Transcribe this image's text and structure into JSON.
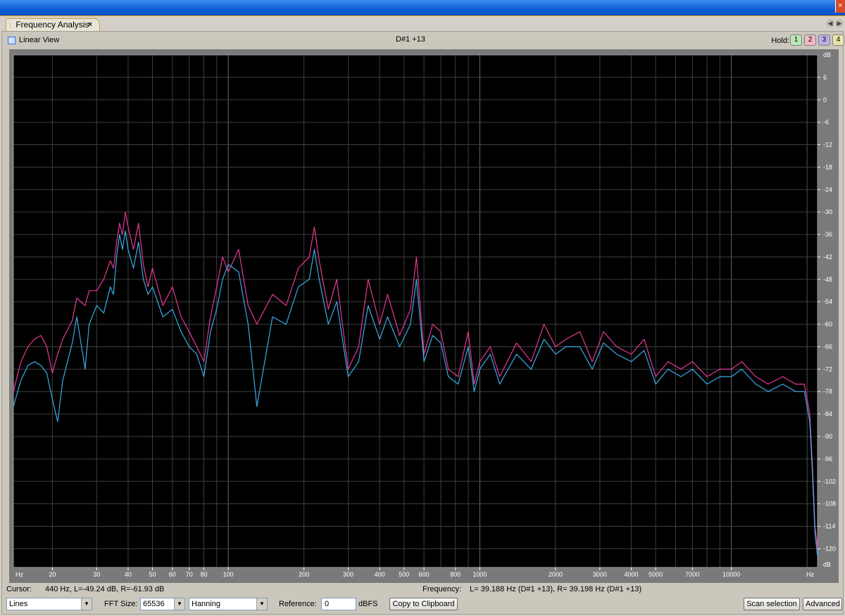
{
  "window": {
    "close_glyph": "×"
  },
  "tab": {
    "label": "Frequency Analysis",
    "close_glyph": "×",
    "grip_glyph": "⁝"
  },
  "tab_scroll": {
    "left_glyph": "◀",
    "right_glyph": "▶"
  },
  "toolbar": {
    "linear_view_label": "Linear View",
    "linear_view_checked": false,
    "pitch_readout": "D#1 +13",
    "hold_label": "Hold:",
    "hold_buttons": [
      "1",
      "2",
      "3",
      "4"
    ]
  },
  "status": {
    "cursor_label": "Cursor:",
    "cursor_value": "440 Hz, L=-49.24 dB, R=-61.93 dB",
    "frequency_label": "Frequency:",
    "frequency_value": "L= 39.188 Hz (D#1 +13), R= 39.198 Hz (D#1 +13)"
  },
  "controls": {
    "plot_style": "Lines",
    "fft_size_label": "FFT Size:",
    "fft_size": "65536",
    "window_function": "Hanning",
    "reference_label": "Reference:",
    "reference_value": "0",
    "reference_unit": "dBFS",
    "copy_button": "Copy to Clipboard",
    "scan_button": "Scan selection",
    "advanced_button": "Advanced"
  },
  "chart_data": {
    "type": "line",
    "x_scale": "log",
    "xlim": [
      14,
      22000
    ],
    "ylim": [
      -125,
      12
    ],
    "grid": true,
    "background": "#000000",
    "x_unit_left": "Hz",
    "x_unit_right": "Hz",
    "y_unit_top": "dB",
    "y_unit_bottom": "dB",
    "x_tick_labels": [
      {
        "v": 20,
        "t": "20"
      },
      {
        "v": 30,
        "t": "30"
      },
      {
        "v": 40,
        "t": "40"
      },
      {
        "v": 50,
        "t": "50"
      },
      {
        "v": 60,
        "t": "60"
      },
      {
        "v": 70,
        "t": "70"
      },
      {
        "v": 80,
        "t": "80"
      },
      {
        "v": 100,
        "t": "100"
      },
      {
        "v": 200,
        "t": "200"
      },
      {
        "v": 300,
        "t": "300"
      },
      {
        "v": 400,
        "t": "400"
      },
      {
        "v": 500,
        "t": "500"
      },
      {
        "v": 600,
        "t": "600"
      },
      {
        "v": 800,
        "t": "800"
      },
      {
        "v": 1000,
        "t": "1000"
      },
      {
        "v": 2000,
        "t": "2000"
      },
      {
        "v": 3000,
        "t": "3000"
      },
      {
        "v": 4000,
        "t": "4000"
      },
      {
        "v": 5000,
        "t": "5000"
      },
      {
        "v": 7000,
        "t": "7000"
      },
      {
        "v": 10000,
        "t": "10000"
      }
    ],
    "y_ticks": [
      6,
      0,
      -6,
      -12,
      -18,
      -24,
      -30,
      -36,
      -42,
      -48,
      -54,
      -60,
      -66,
      -72,
      -78,
      -84,
      -90,
      -96,
      -102,
      -108,
      -114,
      -120
    ],
    "series": [
      {
        "color": "#ff3ea5",
        "points": [
          [
            14,
            -78
          ],
          [
            15,
            -70
          ],
          [
            16,
            -66
          ],
          [
            17,
            -64
          ],
          [
            18,
            -63
          ],
          [
            19,
            -66
          ],
          [
            20,
            -73
          ],
          [
            21,
            -68
          ],
          [
            22,
            -64
          ],
          [
            24,
            -59
          ],
          [
            25,
            -53
          ],
          [
            27,
            -55
          ],
          [
            28,
            -51
          ],
          [
            30,
            -51
          ],
          [
            32,
            -48
          ],
          [
            34,
            -43
          ],
          [
            35,
            -45
          ],
          [
            36,
            -38
          ],
          [
            37,
            -33
          ],
          [
            38,
            -36
          ],
          [
            39,
            -30
          ],
          [
            40,
            -34
          ],
          [
            42,
            -40
          ],
          [
            44,
            -33
          ],
          [
            46,
            -44
          ],
          [
            48,
            -50
          ],
          [
            50,
            -45
          ],
          [
            55,
            -55
          ],
          [
            60,
            -50
          ],
          [
            65,
            -58
          ],
          [
            70,
            -62
          ],
          [
            75,
            -66
          ],
          [
            80,
            -70
          ],
          [
            85,
            -58
          ],
          [
            90,
            -50
          ],
          [
            95,
            -42
          ],
          [
            100,
            -46
          ],
          [
            110,
            -40
          ],
          [
            120,
            -55
          ],
          [
            130,
            -60
          ],
          [
            150,
            -52
          ],
          [
            170,
            -55
          ],
          [
            190,
            -45
          ],
          [
            210,
            -42
          ],
          [
            220,
            -34
          ],
          [
            230,
            -43
          ],
          [
            250,
            -56
          ],
          [
            270,
            -48
          ],
          [
            300,
            -72
          ],
          [
            330,
            -66
          ],
          [
            360,
            -48
          ],
          [
            400,
            -60
          ],
          [
            430,
            -52
          ],
          [
            480,
            -63
          ],
          [
            530,
            -56
          ],
          [
            560,
            -42
          ],
          [
            600,
            -68
          ],
          [
            650,
            -60
          ],
          [
            700,
            -62
          ],
          [
            750,
            -72
          ],
          [
            820,
            -74
          ],
          [
            900,
            -62
          ],
          [
            950,
            -76
          ],
          [
            1000,
            -70
          ],
          [
            1100,
            -66
          ],
          [
            1200,
            -74
          ],
          [
            1400,
            -65
          ],
          [
            1600,
            -70
          ],
          [
            1800,
            -60
          ],
          [
            2000,
            -66
          ],
          [
            2200,
            -64
          ],
          [
            2500,
            -62
          ],
          [
            2800,
            -70
          ],
          [
            3100,
            -62
          ],
          [
            3500,
            -66
          ],
          [
            4000,
            -68
          ],
          [
            4500,
            -64
          ],
          [
            5000,
            -74
          ],
          [
            5600,
            -70
          ],
          [
            6300,
            -72
          ],
          [
            7000,
            -70
          ],
          [
            8000,
            -74
          ],
          [
            9000,
            -72
          ],
          [
            10000,
            -72
          ],
          [
            11000,
            -70
          ],
          [
            12500,
            -74
          ],
          [
            14000,
            -76
          ],
          [
            16000,
            -74
          ],
          [
            18000,
            -76
          ],
          [
            19500,
            -76
          ],
          [
            20500,
            -84
          ],
          [
            21000,
            -98
          ],
          [
            21500,
            -114
          ],
          [
            22000,
            -120
          ]
        ]
      },
      {
        "color": "#3ec0ff",
        "points": [
          [
            14,
            -82
          ],
          [
            15,
            -75
          ],
          [
            16,
            -71
          ],
          [
            17,
            -70
          ],
          [
            18,
            -71
          ],
          [
            19,
            -73
          ],
          [
            20,
            -80
          ],
          [
            21,
            -86
          ],
          [
            22,
            -75
          ],
          [
            24,
            -65
          ],
          [
            25,
            -58
          ],
          [
            27,
            -72
          ],
          [
            28,
            -60
          ],
          [
            30,
            -55
          ],
          [
            32,
            -57
          ],
          [
            34,
            -50
          ],
          [
            35,
            -52
          ],
          [
            36,
            -42
          ],
          [
            37,
            -36
          ],
          [
            38,
            -40
          ],
          [
            39,
            -35
          ],
          [
            40,
            -40
          ],
          [
            42,
            -45
          ],
          [
            44,
            -38
          ],
          [
            46,
            -48
          ],
          [
            48,
            -52
          ],
          [
            50,
            -50
          ],
          [
            55,
            -58
          ],
          [
            60,
            -56
          ],
          [
            65,
            -62
          ],
          [
            70,
            -66
          ],
          [
            75,
            -68
          ],
          [
            80,
            -74
          ],
          [
            85,
            -62
          ],
          [
            90,
            -56
          ],
          [
            95,
            -48
          ],
          [
            100,
            -44
          ],
          [
            110,
            -46
          ],
          [
            120,
            -60
          ],
          [
            130,
            -82
          ],
          [
            150,
            -58
          ],
          [
            170,
            -60
          ],
          [
            190,
            -50
          ],
          [
            210,
            -48
          ],
          [
            220,
            -40
          ],
          [
            230,
            -48
          ],
          [
            250,
            -60
          ],
          [
            270,
            -54
          ],
          [
            300,
            -74
          ],
          [
            330,
            -70
          ],
          [
            360,
            -55
          ],
          [
            400,
            -64
          ],
          [
            430,
            -58
          ],
          [
            480,
            -66
          ],
          [
            530,
            -60
          ],
          [
            560,
            -48
          ],
          [
            600,
            -70
          ],
          [
            650,
            -63
          ],
          [
            700,
            -65
          ],
          [
            750,
            -74
          ],
          [
            820,
            -76
          ],
          [
            900,
            -66
          ],
          [
            950,
            -78
          ],
          [
            1000,
            -72
          ],
          [
            1100,
            -68
          ],
          [
            1200,
            -76
          ],
          [
            1400,
            -68
          ],
          [
            1600,
            -72
          ],
          [
            1800,
            -64
          ],
          [
            2000,
            -68
          ],
          [
            2200,
            -66
          ],
          [
            2500,
            -66
          ],
          [
            2800,
            -72
          ],
          [
            3100,
            -65
          ],
          [
            3500,
            -68
          ],
          [
            4000,
            -70
          ],
          [
            4500,
            -67
          ],
          [
            5000,
            -76
          ],
          [
            5600,
            -72
          ],
          [
            6300,
            -74
          ],
          [
            7000,
            -72
          ],
          [
            8000,
            -76
          ],
          [
            9000,
            -74
          ],
          [
            10000,
            -74
          ],
          [
            11000,
            -72
          ],
          [
            12500,
            -76
          ],
          [
            14000,
            -78
          ],
          [
            16000,
            -76
          ],
          [
            18000,
            -78
          ],
          [
            19500,
            -78
          ],
          [
            20500,
            -86
          ],
          [
            21000,
            -100
          ],
          [
            21500,
            -116
          ],
          [
            22000,
            -122
          ]
        ]
      }
    ]
  }
}
